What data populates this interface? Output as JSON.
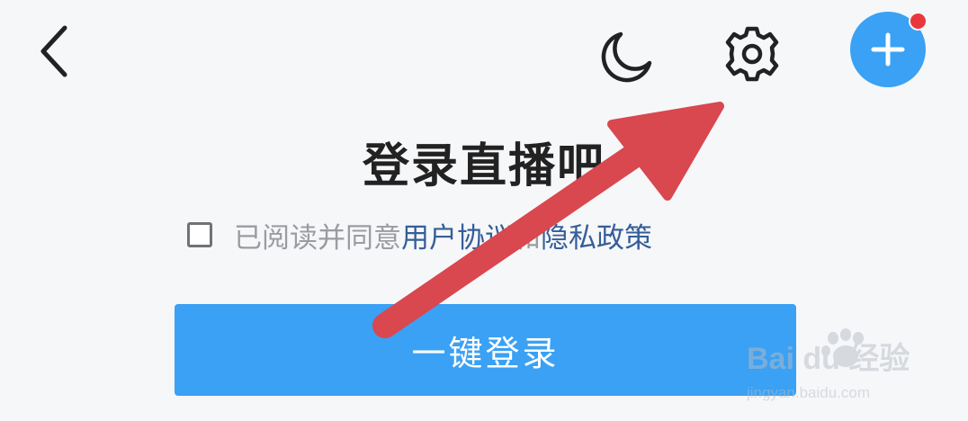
{
  "header": {
    "back_icon": "chevron-left-icon",
    "night_icon": "moon-icon",
    "settings_icon": "gear-icon",
    "add_icon": "plus-icon",
    "notification_dot_color": "#e8383d",
    "accent_color": "#3aa1f4"
  },
  "login": {
    "title": "登录直播吧",
    "agreement_prefix": "已阅读并同意",
    "user_agreement_link": "用户协议",
    "conjunction": "和",
    "privacy_policy_link": "隐私政策",
    "one_click_login_label": "一键登录"
  },
  "annotation": {
    "arrow_color": "#d9474f"
  },
  "watermark": {
    "logo_text": "Bai du 经验",
    "url_text": "jingyan.baidu.com"
  }
}
